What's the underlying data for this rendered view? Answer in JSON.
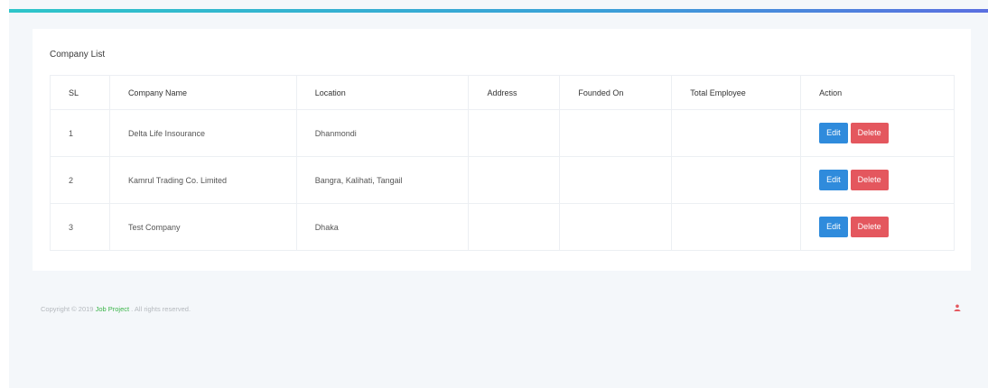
{
  "card": {
    "title": "Company List"
  },
  "table": {
    "headers": [
      "SL",
      "Company Name",
      "Location",
      "Address",
      "Founded On",
      "Total Employee",
      "Action"
    ],
    "rows": [
      {
        "sl": "1",
        "name": "Delta Life Insourance",
        "location": "Dhanmondi",
        "address": "",
        "founded": "",
        "employees": ""
      },
      {
        "sl": "2",
        "name": "Kamrul Trading Co. Limited",
        "location": "Bangra, Kalihati, Tangail",
        "address": "",
        "founded": "",
        "employees": ""
      },
      {
        "sl": "3",
        "name": "Test Company",
        "location": "Dhaka",
        "address": "",
        "founded": "",
        "employees": ""
      }
    ],
    "edit_label": "Edit",
    "delete_label": "Delete"
  },
  "footer": {
    "prefix": "Copyright © 2019 ",
    "link": "Job Project",
    "suffix": " . All rights reserved."
  },
  "colors": {
    "accent_gradient_start": "#2ec5c9",
    "accent_gradient_end": "#5a6fe0",
    "edit": "#2f8bdc",
    "delete": "#e4575e",
    "footer_link": "#3bb54a"
  },
  "icons": {
    "corner": "user-icon"
  }
}
